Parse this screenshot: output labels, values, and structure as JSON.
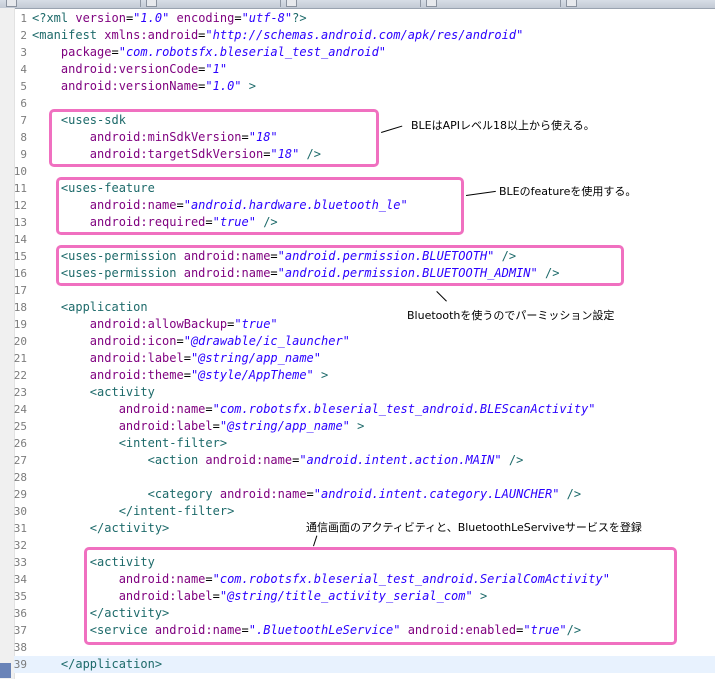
{
  "tabs": [
    {
      "label": ""
    },
    {
      "label": ""
    },
    {
      "label": ""
    },
    {
      "label": ""
    },
    {
      "label": ""
    }
  ],
  "colors": {
    "annotation_border": "#f070c0",
    "tag": "#1d6a6a",
    "attribute": "#7f007f",
    "value": "#2a00ff",
    "current_line": "#e8f2fe"
  },
  "code_lines": [
    {
      "n": "1",
      "tokens": [
        [
          "t",
          "<?xml "
        ],
        [
          "a",
          "version"
        ],
        [
          "eq",
          "="
        ],
        [
          "v",
          "\"1.0\""
        ],
        [
          "a",
          " encoding"
        ],
        [
          "eq",
          "="
        ],
        [
          "v",
          "\"utf-8\""
        ],
        [
          "t",
          "?>"
        ]
      ]
    },
    {
      "n": "2",
      "tokens": [
        [
          "t",
          "<manifest "
        ],
        [
          "a",
          "xmlns:android"
        ],
        [
          "eq",
          "="
        ],
        [
          "v",
          "\"http://schemas.android.com/apk/res/android\""
        ]
      ]
    },
    {
      "n": "3",
      "tokens": [
        [
          "a",
          "    package"
        ],
        [
          "eq",
          "="
        ],
        [
          "v",
          "\"com.robotsfx.bleserial_test_android\""
        ]
      ]
    },
    {
      "n": "4",
      "tokens": [
        [
          "a",
          "    android:versionCode"
        ],
        [
          "eq",
          "="
        ],
        [
          "v",
          "\"1\""
        ]
      ]
    },
    {
      "n": "5",
      "tokens": [
        [
          "a",
          "    android:versionName"
        ],
        [
          "eq",
          "="
        ],
        [
          "v",
          "\"1.0\""
        ],
        [
          "t",
          " >"
        ]
      ]
    },
    {
      "n": "6",
      "tokens": []
    },
    {
      "n": "7",
      "tokens": [
        [
          "t",
          "    <uses-sdk"
        ]
      ]
    },
    {
      "n": "8",
      "tokens": [
        [
          "a",
          "        android:minSdkVersion"
        ],
        [
          "eq",
          "="
        ],
        [
          "v",
          "\"18\""
        ]
      ]
    },
    {
      "n": "9",
      "tokens": [
        [
          "a",
          "        android:targetSdkVersion"
        ],
        [
          "eq",
          "="
        ],
        [
          "v",
          "\"18\""
        ],
        [
          "t",
          " />"
        ]
      ]
    },
    {
      "n": "10",
      "tokens": []
    },
    {
      "n": "11",
      "tokens": [
        [
          "t",
          "    <uses-feature"
        ]
      ]
    },
    {
      "n": "12",
      "tokens": [
        [
          "a",
          "        android:name"
        ],
        [
          "eq",
          "="
        ],
        [
          "v",
          "\"android.hardware.bluetooth_le\""
        ]
      ]
    },
    {
      "n": "13",
      "tokens": [
        [
          "a",
          "        android:required"
        ],
        [
          "eq",
          "="
        ],
        [
          "v",
          "\"true\""
        ],
        [
          "t",
          " />"
        ]
      ]
    },
    {
      "n": "14",
      "tokens": []
    },
    {
      "n": "15",
      "tokens": [
        [
          "t",
          "    <uses-permission "
        ],
        [
          "a",
          "android:name"
        ],
        [
          "eq",
          "="
        ],
        [
          "v",
          "\"android.permission.BLUETOOTH\""
        ],
        [
          "t",
          " />"
        ]
      ]
    },
    {
      "n": "16",
      "tokens": [
        [
          "t",
          "    <uses-permission "
        ],
        [
          "a",
          "android:name"
        ],
        [
          "eq",
          "="
        ],
        [
          "v",
          "\"android.permission.BLUETOOTH_ADMIN\""
        ],
        [
          "t",
          " />"
        ]
      ]
    },
    {
      "n": "17",
      "tokens": []
    },
    {
      "n": "18",
      "tokens": [
        [
          "t",
          "    <application"
        ]
      ]
    },
    {
      "n": "19",
      "tokens": [
        [
          "a",
          "        android:allowBackup"
        ],
        [
          "eq",
          "="
        ],
        [
          "v",
          "\"true\""
        ]
      ]
    },
    {
      "n": "20",
      "tokens": [
        [
          "a",
          "        android:icon"
        ],
        [
          "eq",
          "="
        ],
        [
          "v",
          "\"@drawable/ic_launcher\""
        ]
      ]
    },
    {
      "n": "21",
      "tokens": [
        [
          "a",
          "        android:label"
        ],
        [
          "eq",
          "="
        ],
        [
          "v",
          "\"@string/app_name\""
        ]
      ]
    },
    {
      "n": "22",
      "tokens": [
        [
          "a",
          "        android:theme"
        ],
        [
          "eq",
          "="
        ],
        [
          "v",
          "\"@style/AppTheme\""
        ],
        [
          "t",
          " >"
        ]
      ]
    },
    {
      "n": "23",
      "tokens": [
        [
          "t",
          "        <activity"
        ]
      ]
    },
    {
      "n": "24",
      "tokens": [
        [
          "a",
          "            android:name"
        ],
        [
          "eq",
          "="
        ],
        [
          "v",
          "\"com.robotsfx.bleserial_test_android.BLEScanActivity\""
        ]
      ]
    },
    {
      "n": "25",
      "tokens": [
        [
          "a",
          "            android:label"
        ],
        [
          "eq",
          "="
        ],
        [
          "v",
          "\"@string/app_name\""
        ],
        [
          "t",
          " >"
        ]
      ]
    },
    {
      "n": "26",
      "tokens": [
        [
          "t",
          "            <intent-filter>"
        ]
      ]
    },
    {
      "n": "27",
      "tokens": [
        [
          "t",
          "                <action "
        ],
        [
          "a",
          "android:name"
        ],
        [
          "eq",
          "="
        ],
        [
          "v",
          "\"android.intent.action.MAIN\""
        ],
        [
          "t",
          " />"
        ]
      ]
    },
    {
      "n": "28",
      "tokens": []
    },
    {
      "n": "29",
      "tokens": [
        [
          "t",
          "                <category "
        ],
        [
          "a",
          "android:name"
        ],
        [
          "eq",
          "="
        ],
        [
          "v",
          "\"android.intent.category.LAUNCHER\""
        ],
        [
          "t",
          " />"
        ]
      ]
    },
    {
      "n": "30",
      "tokens": [
        [
          "t",
          "            </intent-filter>"
        ]
      ]
    },
    {
      "n": "31",
      "tokens": [
        [
          "t",
          "        </activity>"
        ]
      ]
    },
    {
      "n": "32",
      "tokens": []
    },
    {
      "n": "33",
      "tokens": [
        [
          "t",
          "        <activity"
        ]
      ]
    },
    {
      "n": "34",
      "tokens": [
        [
          "a",
          "            android:name"
        ],
        [
          "eq",
          "="
        ],
        [
          "v",
          "\"com.robotsfx.bleserial_test_android.SerialComActivity\""
        ]
      ]
    },
    {
      "n": "35",
      "tokens": [
        [
          "a",
          "            android:label"
        ],
        [
          "eq",
          "="
        ],
        [
          "v",
          "\"@string/title_activity_serial_com\""
        ],
        [
          "t",
          " >"
        ]
      ]
    },
    {
      "n": "36",
      "tokens": [
        [
          "t",
          "        </activity>"
        ]
      ]
    },
    {
      "n": "37",
      "tokens": [
        [
          "t",
          "        <service "
        ],
        [
          "a",
          "android:name"
        ],
        [
          "eq",
          "="
        ],
        [
          "v",
          "\".BluetoothLeService\""
        ],
        [
          "a",
          " android:enabled"
        ],
        [
          "eq",
          "="
        ],
        [
          "v",
          "\"true\""
        ],
        [
          "t",
          "/>"
        ]
      ]
    },
    {
      "n": "38",
      "tokens": []
    },
    {
      "n": "39",
      "tokens": [
        [
          "t",
          "    </application>"
        ]
      ]
    }
  ],
  "current_line": "39",
  "annotations": {
    "sdk": "BLEはAPIレベル18以上から使える。",
    "feature": "BLEのfeatureを使用する。",
    "permission": "Bluetoothを使うのでパーミッション設定",
    "service": "通信画面のアクティビティと、BluetoothLeServiveサービスを登録"
  }
}
